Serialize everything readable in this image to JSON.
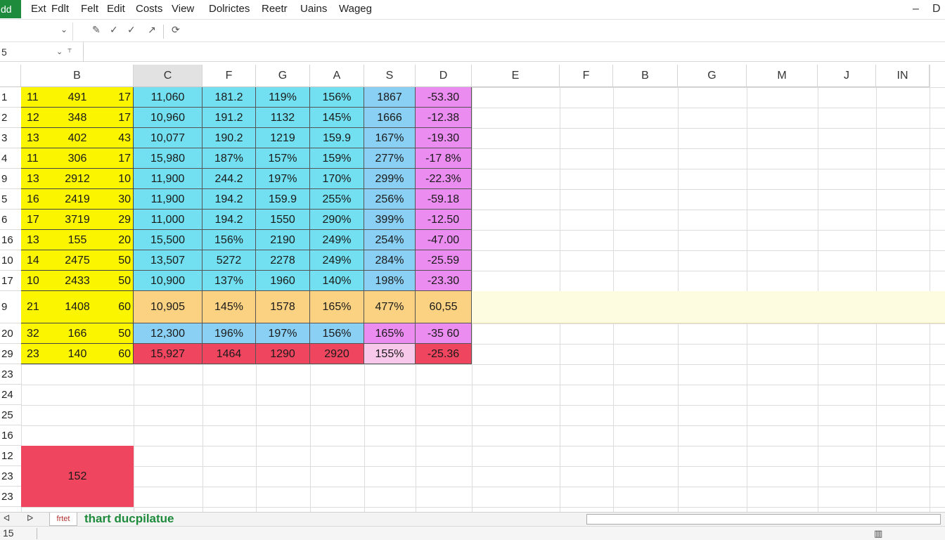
{
  "app": {
    "badge": "dd"
  },
  "menu": [
    "Ext",
    "Fdlt",
    "Felt",
    "Edit",
    "Costs",
    "View",
    "Dolrictes",
    "Reetr",
    "Uains",
    "Wageg"
  ],
  "window": {
    "minimize": "–",
    "restore": "D"
  },
  "toolbar": {
    "font_dropdown": "⌄",
    "icons": [
      "✎",
      "✓",
      "✓",
      "↗",
      "⟳"
    ]
  },
  "formula_bar": {
    "name_box": "5",
    "value": ""
  },
  "columns": [
    "B",
    "C",
    "F",
    "G",
    "A",
    "S",
    "D",
    "E",
    "F",
    "B",
    "G",
    "M",
    "J",
    "IN"
  ],
  "rows": [
    {
      "row": "1",
      "b1": "11",
      "b2": "491",
      "b3": "17",
      "c": "11,060",
      "f": "181.2",
      "g": "119%",
      "a": "156%",
      "s": "1867",
      "d": "-53.30"
    },
    {
      "row": "2",
      "b1": "12",
      "b2": "348",
      "b3": "17",
      "c": "10,960",
      "f": "191.2",
      "g": "1132",
      "a": "145%",
      "s": "1666",
      "d": "-12.38"
    },
    {
      "row": "3",
      "b1": "13",
      "b2": "402",
      "b3": "43",
      "c": "10,077",
      "f": "190.2",
      "g": "1219",
      "a": "159.9",
      "s": "167%",
      "d": "-19.30"
    },
    {
      "row": "4",
      "b1": "11",
      "b2": "306",
      "b3": "17",
      "c": "15,980",
      "f": "187%",
      "g": "157%",
      "a": "159%",
      "s": "277%",
      "d": "-17 8%"
    },
    {
      "row": "9",
      "b1": "13",
      "b2": "2912",
      "b3": "10",
      "c": "11,900",
      "f": "244.2",
      "g": "197%",
      "a": "170%",
      "s": "299%",
      "d": "-22.3%"
    },
    {
      "row": "5",
      "b1": "16",
      "b2": "2419",
      "b3": "30",
      "c": "11,900",
      "f": "194.2",
      "g": "159.9",
      "a": "255%",
      "s": "256%",
      "d": "-59.18"
    },
    {
      "row": "6",
      "b1": "17",
      "b2": "3719",
      "b3": "29",
      "c": "11,000",
      "f": "194.2",
      "g": "1550",
      "a": "290%",
      "s": "399%",
      "d": "-12.50"
    },
    {
      "row": "16",
      "b1": "13",
      "b2": "155",
      "b3": "20",
      "c": "15,500",
      "f": "156%",
      "g": "2190",
      "a": "249%",
      "s": "254%",
      "d": "-47.00"
    },
    {
      "row": "10",
      "b1": "14",
      "b2": "2475",
      "b3": "50",
      "c": "13,507",
      "f": "5272",
      "g": "2278",
      "a": "249%",
      "s": "284%",
      "d": "-25.59"
    },
    {
      "row": "17",
      "b1": "10",
      "b2": "2433",
      "b3": "50",
      "c": "10,900",
      "f": "137%",
      "g": "1960",
      "a": "140%",
      "s": "198%",
      "d": "-23.30"
    },
    {
      "row": "9",
      "b1": "21",
      "b2": "1408",
      "b3": "60",
      "c": "10,905",
      "f": "145%",
      "g": "1578",
      "a": "165%",
      "s": "477%",
      "d": "60,55"
    },
    {
      "row": "20",
      "b1": "32",
      "b2": "166",
      "b3": "50",
      "c": "12,300",
      "f": "196%",
      "g": "197%",
      "a": "156%",
      "s": "165%",
      "d": "-35 60"
    },
    {
      "row": "29",
      "b1": "23",
      "b2": "140",
      "b3": "60",
      "c": "15,927",
      "f": "1464",
      "g": "1290",
      "a": "2920",
      "s": "155%",
      "d": "-25.36"
    }
  ],
  "empty_rows": [
    "23",
    "24",
    "25",
    "16",
    "12",
    "23",
    "23"
  ],
  "red_block_value": "152",
  "colors": {
    "yellow": "#fbf500",
    "cyan": "#72e0f0",
    "blue": "#8ad0f4",
    "violet": "#ea8cf0",
    "orange": "#fad282",
    "pale_yellow": "#fdfbe0",
    "red": "#f0455e",
    "pink": "#f8c8ea"
  },
  "tabs": {
    "nav": [
      "ᐊ",
      "ᐅ"
    ],
    "sheet": "frtet",
    "title": "thart ducpilatue"
  },
  "status": {
    "text": "15",
    "view_icon": "▥"
  }
}
